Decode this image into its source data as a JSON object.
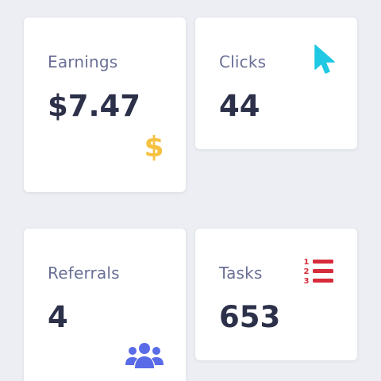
{
  "cards": [
    {
      "label": "Earnings",
      "value": "$7.47",
      "icon": "dollar-icon",
      "icon_color": "#f5c242"
    },
    {
      "label": "Clicks",
      "value": "44",
      "icon": "cursor-pointer-icon",
      "icon_color": "#1fc8e3"
    },
    {
      "label": "Referrals",
      "value": "4",
      "icon": "users-group-icon",
      "icon_color": "#5a6be8"
    },
    {
      "label": "Tasks",
      "value": "653",
      "icon": "numbered-list-icon",
      "icon_color": "#d62b3a"
    }
  ],
  "colors": {
    "background": "#eceef3",
    "card": "#ffffff",
    "label": "#6a6f96",
    "value": "#2c3049"
  }
}
